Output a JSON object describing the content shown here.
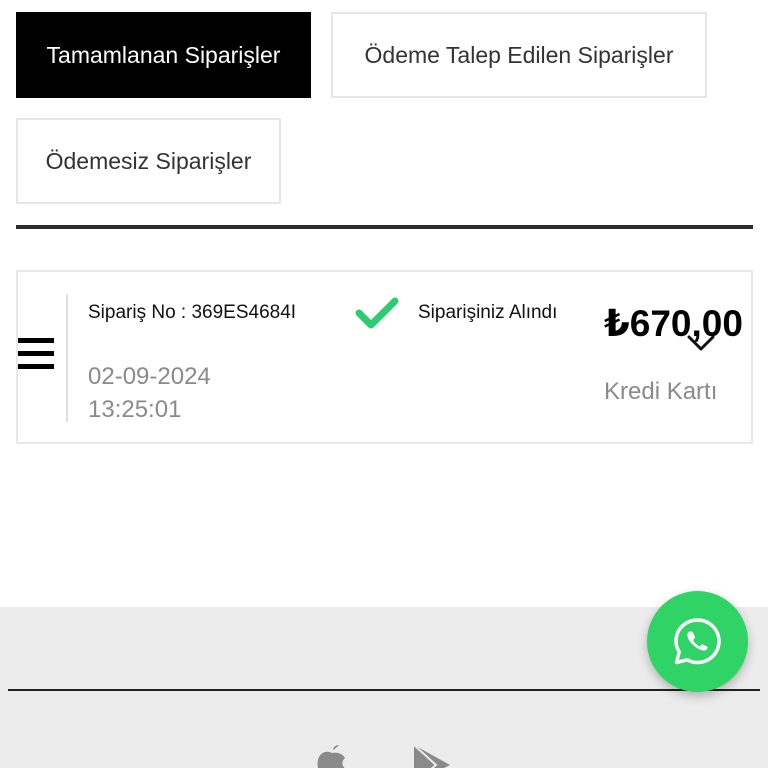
{
  "tabs": {
    "completed": "Tamamlanan Siparişler",
    "payment_requested": "Ödeme Talep Edilen Siparişler",
    "unpaid": "Ödemesiz Siparişler"
  },
  "order": {
    "number": "Sipariş No : 369ES4684I",
    "date": "02-09-2024",
    "time": "13:25:01",
    "status": "Siparişiniz Alındı",
    "price": "₺670,00",
    "payment_method": "Kredi Kartı"
  },
  "colors": {
    "active_tab": "#000000",
    "status_check": "#2ecc71",
    "whatsapp": "#2fd366",
    "footer_bg": "#ececec"
  },
  "icons": {
    "menu": "menu-icon",
    "status": "check-icon",
    "expand": "chevron-down-icon",
    "whatsapp": "whatsapp-icon",
    "apple": "apple-icon",
    "play_store": "play-store-icon"
  }
}
